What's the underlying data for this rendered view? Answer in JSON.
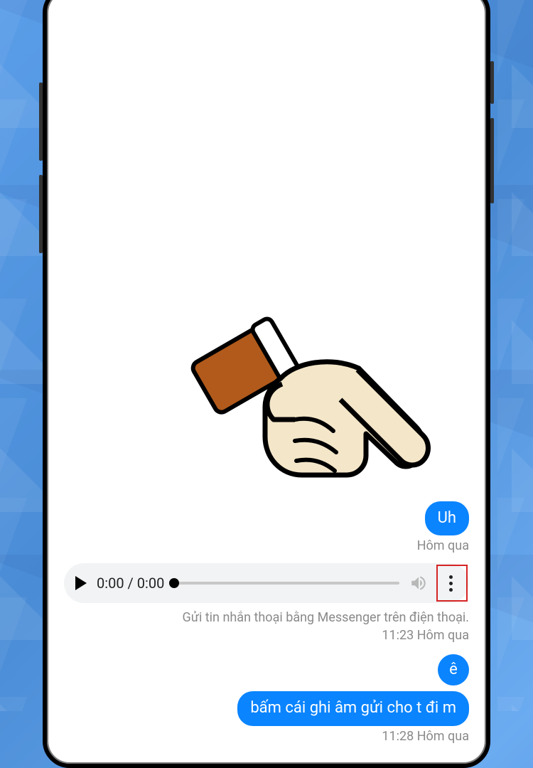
{
  "messages": {
    "uh_label": "Uh",
    "uh_time": "Hôm qua",
    "e_label": "ê",
    "bam_label": "bấm cái ghi âm gửi cho t đi m"
  },
  "audio": {
    "time_display": "0:00 / 0:00",
    "caption": "Gửi tin nhắn thoại bằng Messenger trên điện thoại.",
    "timestamp": "11:23 Hôm qua"
  },
  "last_timestamp": "11:28 Hôm qua"
}
